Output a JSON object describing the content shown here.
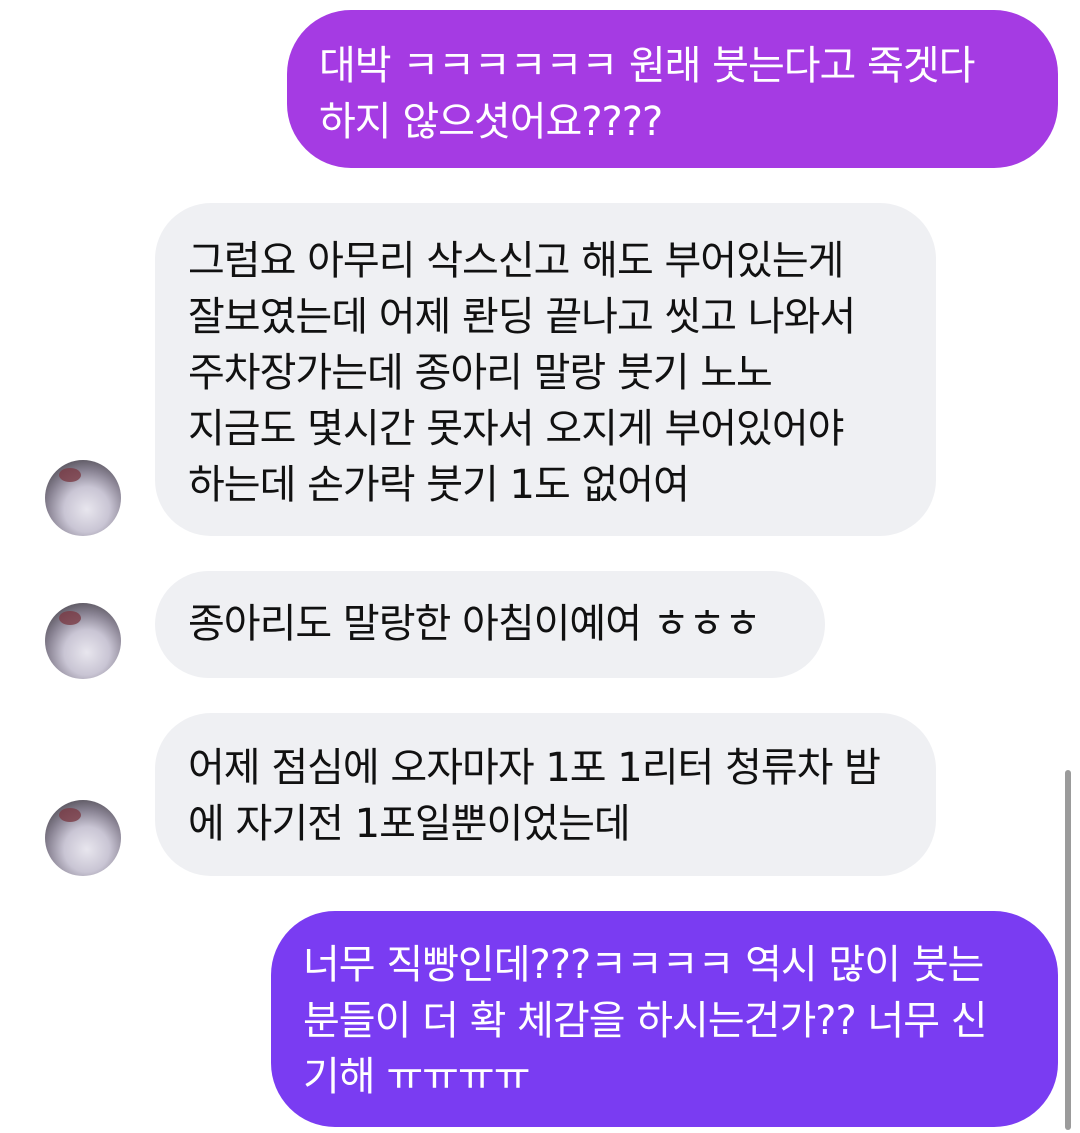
{
  "messages": [
    {
      "side": "sent",
      "lines": [
        "대박 ㅋㅋㅋㅋㅋㅋ 원래 붓는다고 죽겟다",
        "하지 않으셧어요????"
      ]
    },
    {
      "side": "received",
      "lines": [
        "그럼요 아무리 삭스신고 해도 부어있는게",
        "잘보였는데 어제 롼딩 끝나고 씻고 나와서",
        "주차장가는데 종아리 말랑 붓기 노노",
        "지금도 몇시간 못자서 오지게 부어있어야",
        "하는데 손가락 붓기 1도 없어여"
      ]
    },
    {
      "side": "received",
      "lines": [
        "종아리도 말랑한 아침이예여 ㅎㅎㅎ"
      ]
    },
    {
      "side": "received",
      "lines": [
        "어제 점심에 오자마자 1포 1리터 청류차 밤",
        "에 자기전 1포일뿐이었는데"
      ]
    },
    {
      "side": "sent",
      "lines": [
        "너무 직빵인데???ㅋㅋㅋㅋ 역시 많이 붓는",
        "분들이 더 확 체감을 하시는건가?? 너무 신",
        "기해 ㅠㅠㅠㅠ"
      ]
    }
  ],
  "colors": {
    "sent_bubble_1": "#a53be3",
    "sent_bubble_2": "#7a3cf2",
    "received_bubble": "#eff0f3",
    "sent_text": "#ffffff",
    "received_text": "#111111"
  },
  "icons": {
    "avatar": "profile-avatar-icon"
  }
}
